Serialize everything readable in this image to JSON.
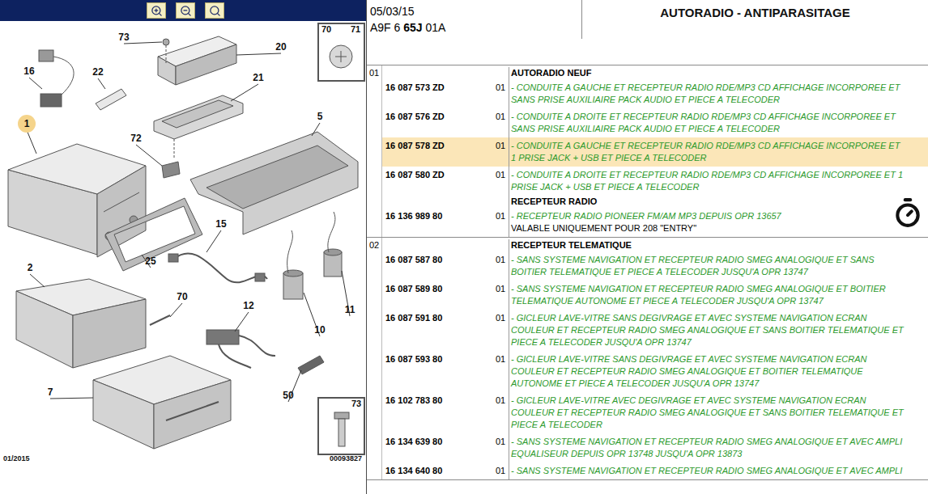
{
  "toolbar": {
    "buttons": [
      "zoom-in",
      "zoom-out",
      "zoom-fit"
    ]
  },
  "diagram": {
    "callouts": [
      {
        "label": "73",
        "highlighted": false
      },
      {
        "label": "20",
        "highlighted": false
      },
      {
        "label": "16",
        "highlighted": false
      },
      {
        "label": "22",
        "highlighted": false
      },
      {
        "label": "21",
        "highlighted": false
      },
      {
        "label": "1",
        "highlighted": true
      },
      {
        "label": "72",
        "highlighted": false
      },
      {
        "label": "5",
        "highlighted": false
      },
      {
        "label": "15",
        "highlighted": false
      },
      {
        "label": "25",
        "highlighted": false
      },
      {
        "label": "2",
        "highlighted": false
      },
      {
        "label": "70",
        "highlighted": false
      },
      {
        "label": "12",
        "highlighted": false
      },
      {
        "label": "11",
        "highlighted": false
      },
      {
        "label": "10",
        "highlighted": false
      },
      {
        "label": "7",
        "highlighted": false
      },
      {
        "label": "50",
        "highlighted": false
      }
    ],
    "inset_top": [
      "70",
      "71"
    ],
    "inset_bottom": [
      "73"
    ],
    "footer_left": "01/2015",
    "footer_right": "00093827"
  },
  "header": {
    "date": "05/03/15",
    "code": [
      {
        "text": "A9F 6 ",
        "bold": false
      },
      {
        "text": "65J",
        "bold": true
      },
      {
        "text": " 01A",
        "bold": false
      }
    ],
    "title": "AUTORADIO - ANTIPARASITAGE"
  },
  "groups": [
    {
      "number": "01",
      "rows": [
        {
          "kind": "heading",
          "text": "AUTORADIO NEUF"
        },
        {
          "kind": "part",
          "part_number": "16 087 573 ZD",
          "qty": "01",
          "selected": false,
          "timer": false,
          "note": "",
          "lines": [
            "- CONDUITE A GAUCHE ET RECEPTEUR RADIO RDE/MP3 CD AFFICHAGE INCORPOREE ET",
            "SANS PRISE AUXILIAIRE PACK AUDIO ET PIECE A TELECODER"
          ]
        },
        {
          "kind": "part",
          "part_number": "16 087 576 ZD",
          "qty": "01",
          "selected": false,
          "timer": false,
          "note": "",
          "lines": [
            "- CONDUITE A DROITE ET RECEPTEUR RADIO RDE/MP3 CD AFFICHAGE INCORPOREE ET",
            "SANS PRISE AUXILIAIRE PACK AUDIO ET PIECE A TELECODER"
          ]
        },
        {
          "kind": "part",
          "part_number": "16 087 578 ZD",
          "qty": "01",
          "selected": true,
          "timer": false,
          "note": "",
          "lines": [
            "- CONDUITE A GAUCHE ET RECEPTEUR RADIO RDE/MP3 CD AFFICHAGE INCORPOREE ET",
            "1 PRISE JACK + USB ET PIECE A TELECODER"
          ]
        },
        {
          "kind": "part",
          "part_number": "16 087 580 ZD",
          "qty": "01",
          "selected": false,
          "timer": false,
          "note": "",
          "lines": [
            "- CONDUITE A DROITE ET RECEPTEUR RADIO RDE/MP3 CD AFFICHAGE INCORPOREE ET 1",
            "PRISE JACK + USB ET PIECE A TELECODER"
          ]
        },
        {
          "kind": "heading",
          "text": "RECEPTEUR RADIO"
        },
        {
          "kind": "part",
          "part_number": "16 136 989 80",
          "qty": "01",
          "selected": false,
          "timer": true,
          "note": "VALABLE UNIQUEMENT POUR 208 \"ENTRY\"",
          "lines": [
            "- RECEPTEUR RADIO PIONEER FM/AM MP3 DEPUIS OPR 13657"
          ]
        }
      ]
    },
    {
      "number": "02",
      "rows": [
        {
          "kind": "heading",
          "text": "RECEPTEUR TELEMATIQUE"
        },
        {
          "kind": "part",
          "part_number": "16 087 587 80",
          "qty": "01",
          "selected": false,
          "timer": false,
          "note": "",
          "lines": [
            "- SANS SYSTEME NAVIGATION ET RECEPTEUR RADIO SMEG ANALOGIQUE ET SANS",
            "BOITIER TELEMATIQUE ET PIECE A TELECODER JUSQU'A OPR 13747"
          ]
        },
        {
          "kind": "part",
          "part_number": "16 087 589 80",
          "qty": "01",
          "selected": false,
          "timer": false,
          "note": "",
          "lines": [
            "- SANS SYSTEME NAVIGATION ET RECEPTEUR RADIO SMEG ANALOGIQUE ET BOITIER",
            "TELEMATIQUE AUTONOME ET PIECE A TELECODER JUSQU'A OPR 13747"
          ]
        },
        {
          "kind": "part",
          "part_number": "16 087 591 80",
          "qty": "01",
          "selected": false,
          "timer": false,
          "note": "",
          "lines": [
            "- GICLEUR LAVE-VITRE SANS DEGIVRAGE ET AVEC SYSTEME NAVIGATION ECRAN",
            "COULEUR ET RECEPTEUR RADIO SMEG ANALOGIQUE ET SANS BOITIER TELEMATIQUE ET",
            "PIECE A TELECODER JUSQU'A OPR 13747"
          ]
        },
        {
          "kind": "part",
          "part_number": "16 087 593 80",
          "qty": "01",
          "selected": false,
          "timer": false,
          "note": "",
          "lines": [
            "- GICLEUR LAVE-VITRE SANS DEGIVRAGE ET AVEC SYSTEME NAVIGATION ECRAN",
            "COULEUR ET RECEPTEUR RADIO SMEG ANALOGIQUE ET BOITIER TELEMATIQUE",
            "AUTONOME ET PIECE A TELECODER JUSQU'A OPR 13747"
          ]
        },
        {
          "kind": "part",
          "part_number": "16 102 783 80",
          "qty": "01",
          "selected": false,
          "timer": false,
          "note": "",
          "lines": [
            "- GICLEUR LAVE-VITRE AVEC DEGIVRAGE ET AVEC SYSTEME NAVIGATION ECRAN",
            "COULEUR ET RECEPTEUR RADIO SMEG ANALOGIQUE ET SANS BOITIER TELEMATIQUE ET",
            "PIECE A TELECODER"
          ]
        },
        {
          "kind": "part",
          "part_number": "16 134 639 80",
          "qty": "01",
          "selected": false,
          "timer": false,
          "note": "",
          "lines": [
            "- SANS SYSTEME NAVIGATION ET RECEPTEUR RADIO SMEG ANALOGIQUE ET AVEC AMPLI",
            "EQUALISEUR DEPUIS OPR 13748 JUSQU'A OPR 13873"
          ]
        },
        {
          "kind": "part",
          "part_number": "16 134 640 80",
          "qty": "01",
          "selected": false,
          "timer": false,
          "note": "",
          "lines": [
            "- SANS SYSTEME NAVIGATION ET RECEPTEUR RADIO SMEG ANALOGIQUE ET AVEC AMPLI"
          ]
        }
      ]
    }
  ]
}
